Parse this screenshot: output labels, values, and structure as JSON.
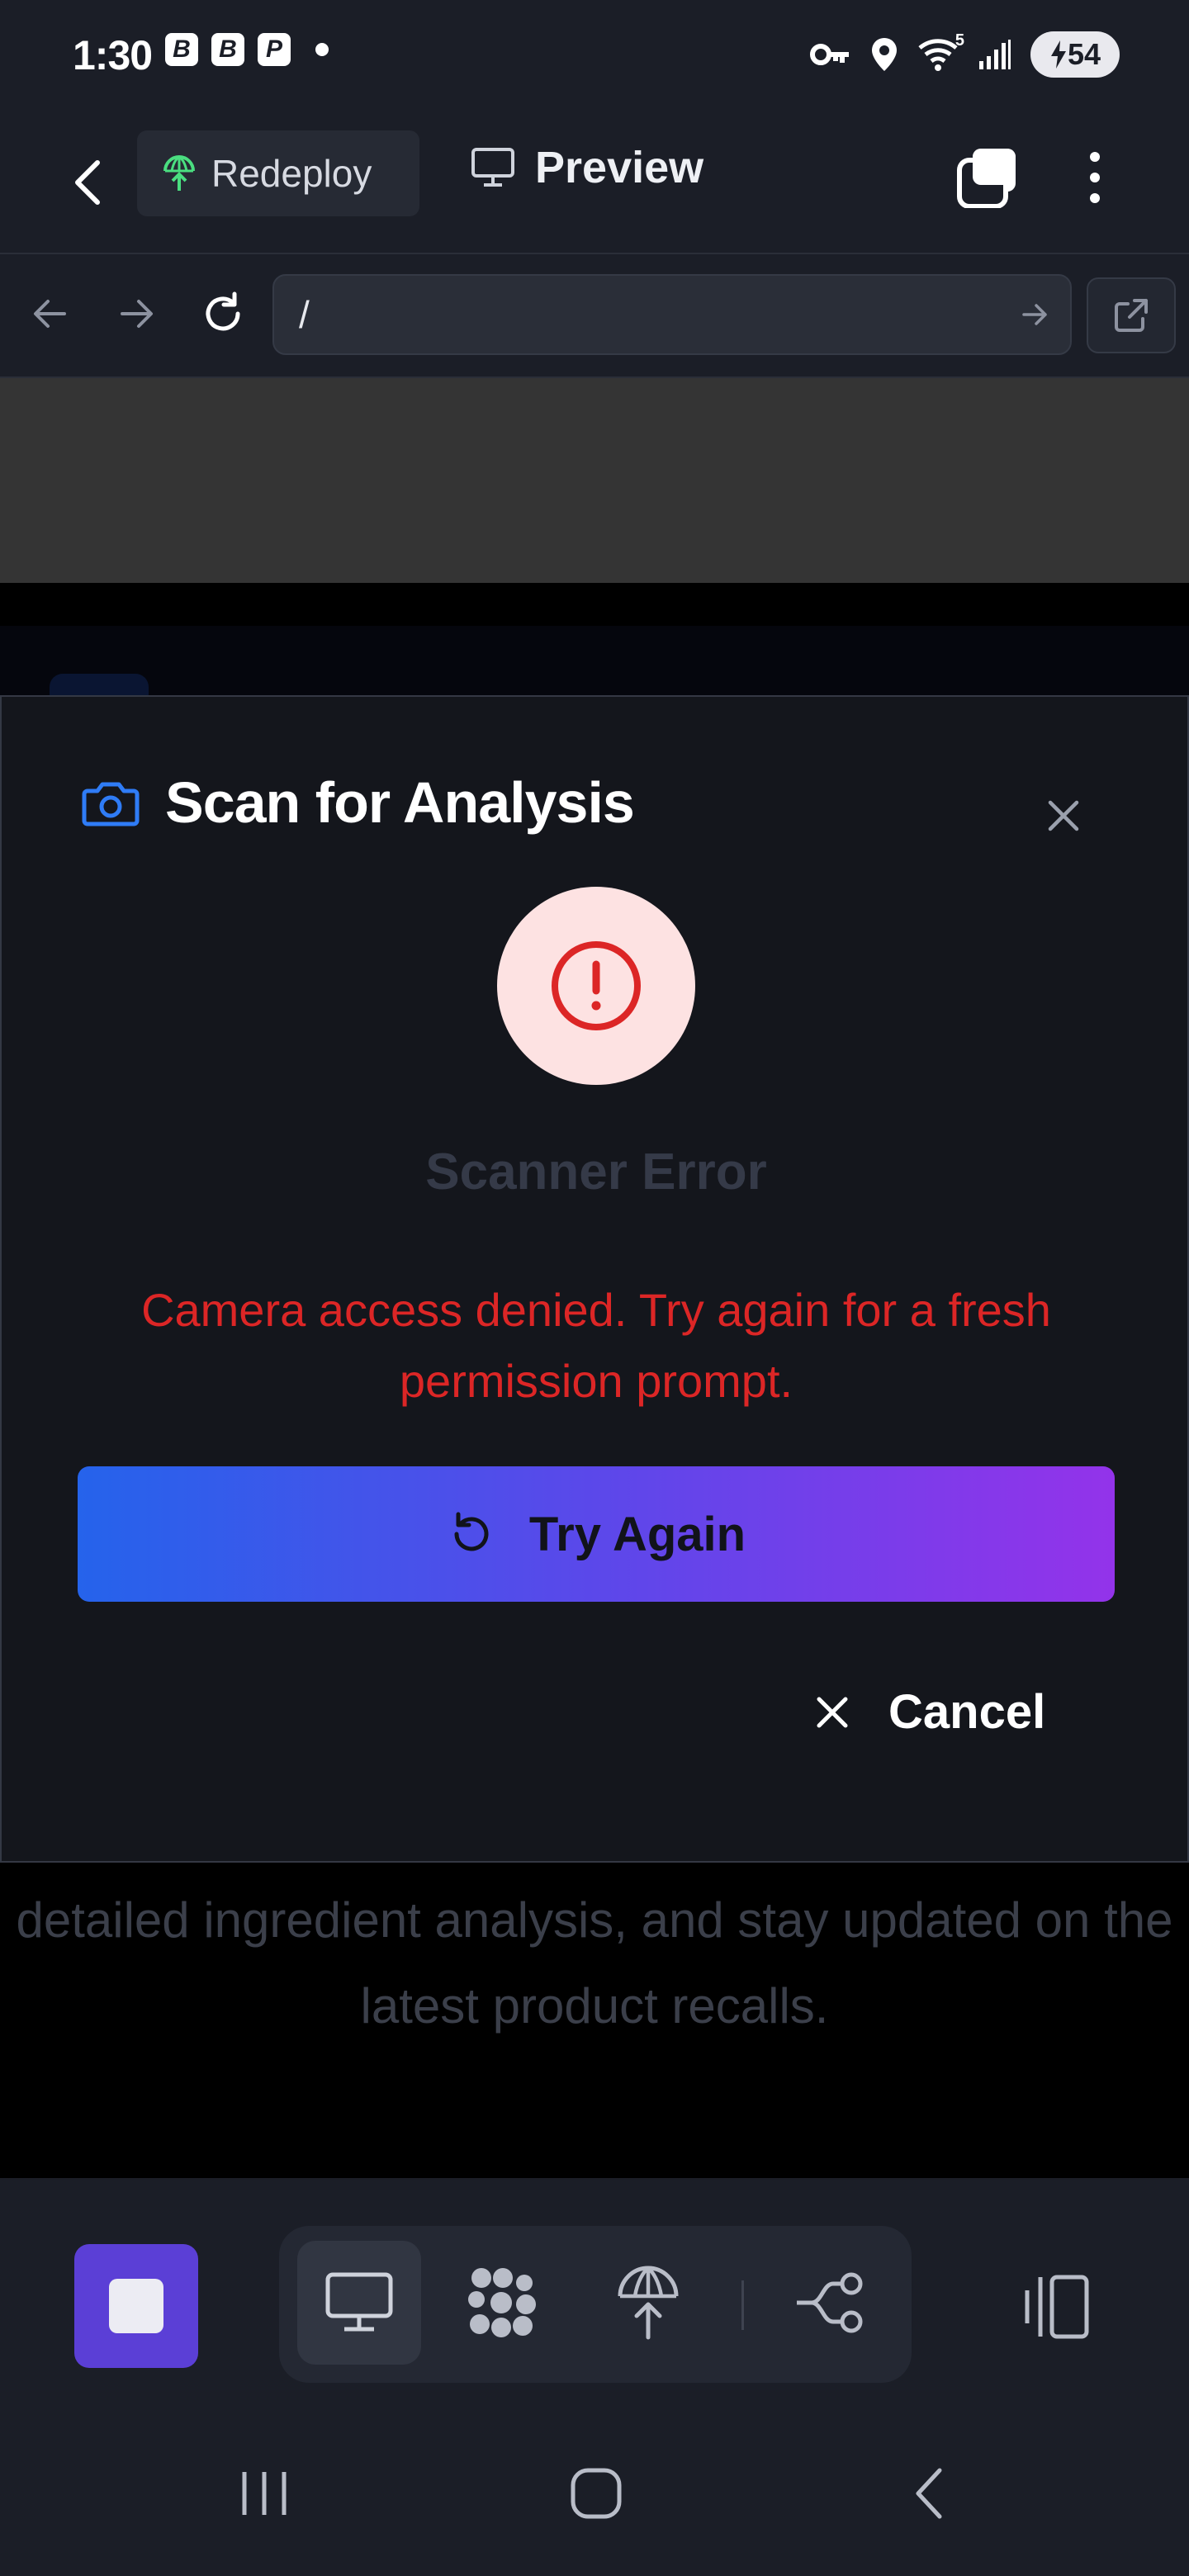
{
  "status_bar": {
    "time": "1:30",
    "notification_icons": [
      "B",
      "B",
      "P"
    ],
    "status_icons": [
      "key-icon",
      "location-icon",
      "wifi-icon",
      "signal-icon"
    ],
    "wifi_label": "5",
    "battery_level": "54"
  },
  "app_header": {
    "back_icon": "chevron-left-icon",
    "redeploy_label": "Redeploy",
    "preview_label": "Preview"
  },
  "browser": {
    "url": "/"
  },
  "webview": {
    "background_text": "detailed ingredient analysis, and stay updated on the latest product recalls."
  },
  "modal": {
    "title": "Scan for Analysis",
    "error_title": "Scanner Error",
    "error_message": "Camera access denied. Try again for a fresh permission prompt.",
    "try_again_label": "Try Again",
    "cancel_label": "Cancel",
    "colors": {
      "accent": "#2563eb",
      "error": "#dc2626",
      "gradient_start": "#2563eb",
      "gradient_end": "#9333ea"
    }
  },
  "bottom_toolbar": {
    "stop_color": "#5b3fd6",
    "tools": [
      "monitor-icon",
      "apps-grid-icon",
      "deploy-icon",
      "git-branch-icon"
    ],
    "active_tool": "monitor-icon"
  }
}
